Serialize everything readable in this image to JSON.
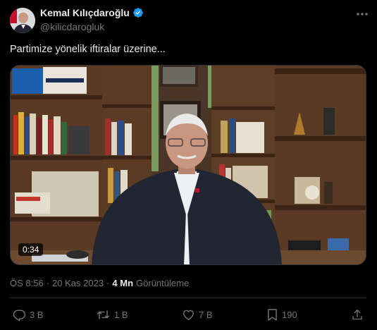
{
  "author": {
    "name": "Kemal Kılıçdaroğlu",
    "handle": "@kilicdarogluk"
  },
  "icons": {
    "verified": "verified-badge-icon",
    "more": "more-options-icon",
    "reply": "reply-icon",
    "retweet": "retweet-icon",
    "like": "like-icon",
    "bookmark": "bookmark-icon",
    "share": "share-icon"
  },
  "colors": {
    "background": "#000000",
    "text": "#e7e9ea",
    "muted": "#71767b",
    "verified": "#1d9bf0",
    "border": "#2f3336"
  },
  "tweet": {
    "text": "Partimize yönelik iftiralar üzerine...",
    "video_duration": "0:34",
    "time": "ÖS 8:56",
    "separator1": "·",
    "date": "20 Kas 2023",
    "separator2": "·",
    "views_count": "4 Mn",
    "views_label": "Görüntüleme"
  },
  "actions": {
    "replies": "3 B",
    "retweets": "1 B",
    "likes": "7 B",
    "bookmarks": "190"
  }
}
